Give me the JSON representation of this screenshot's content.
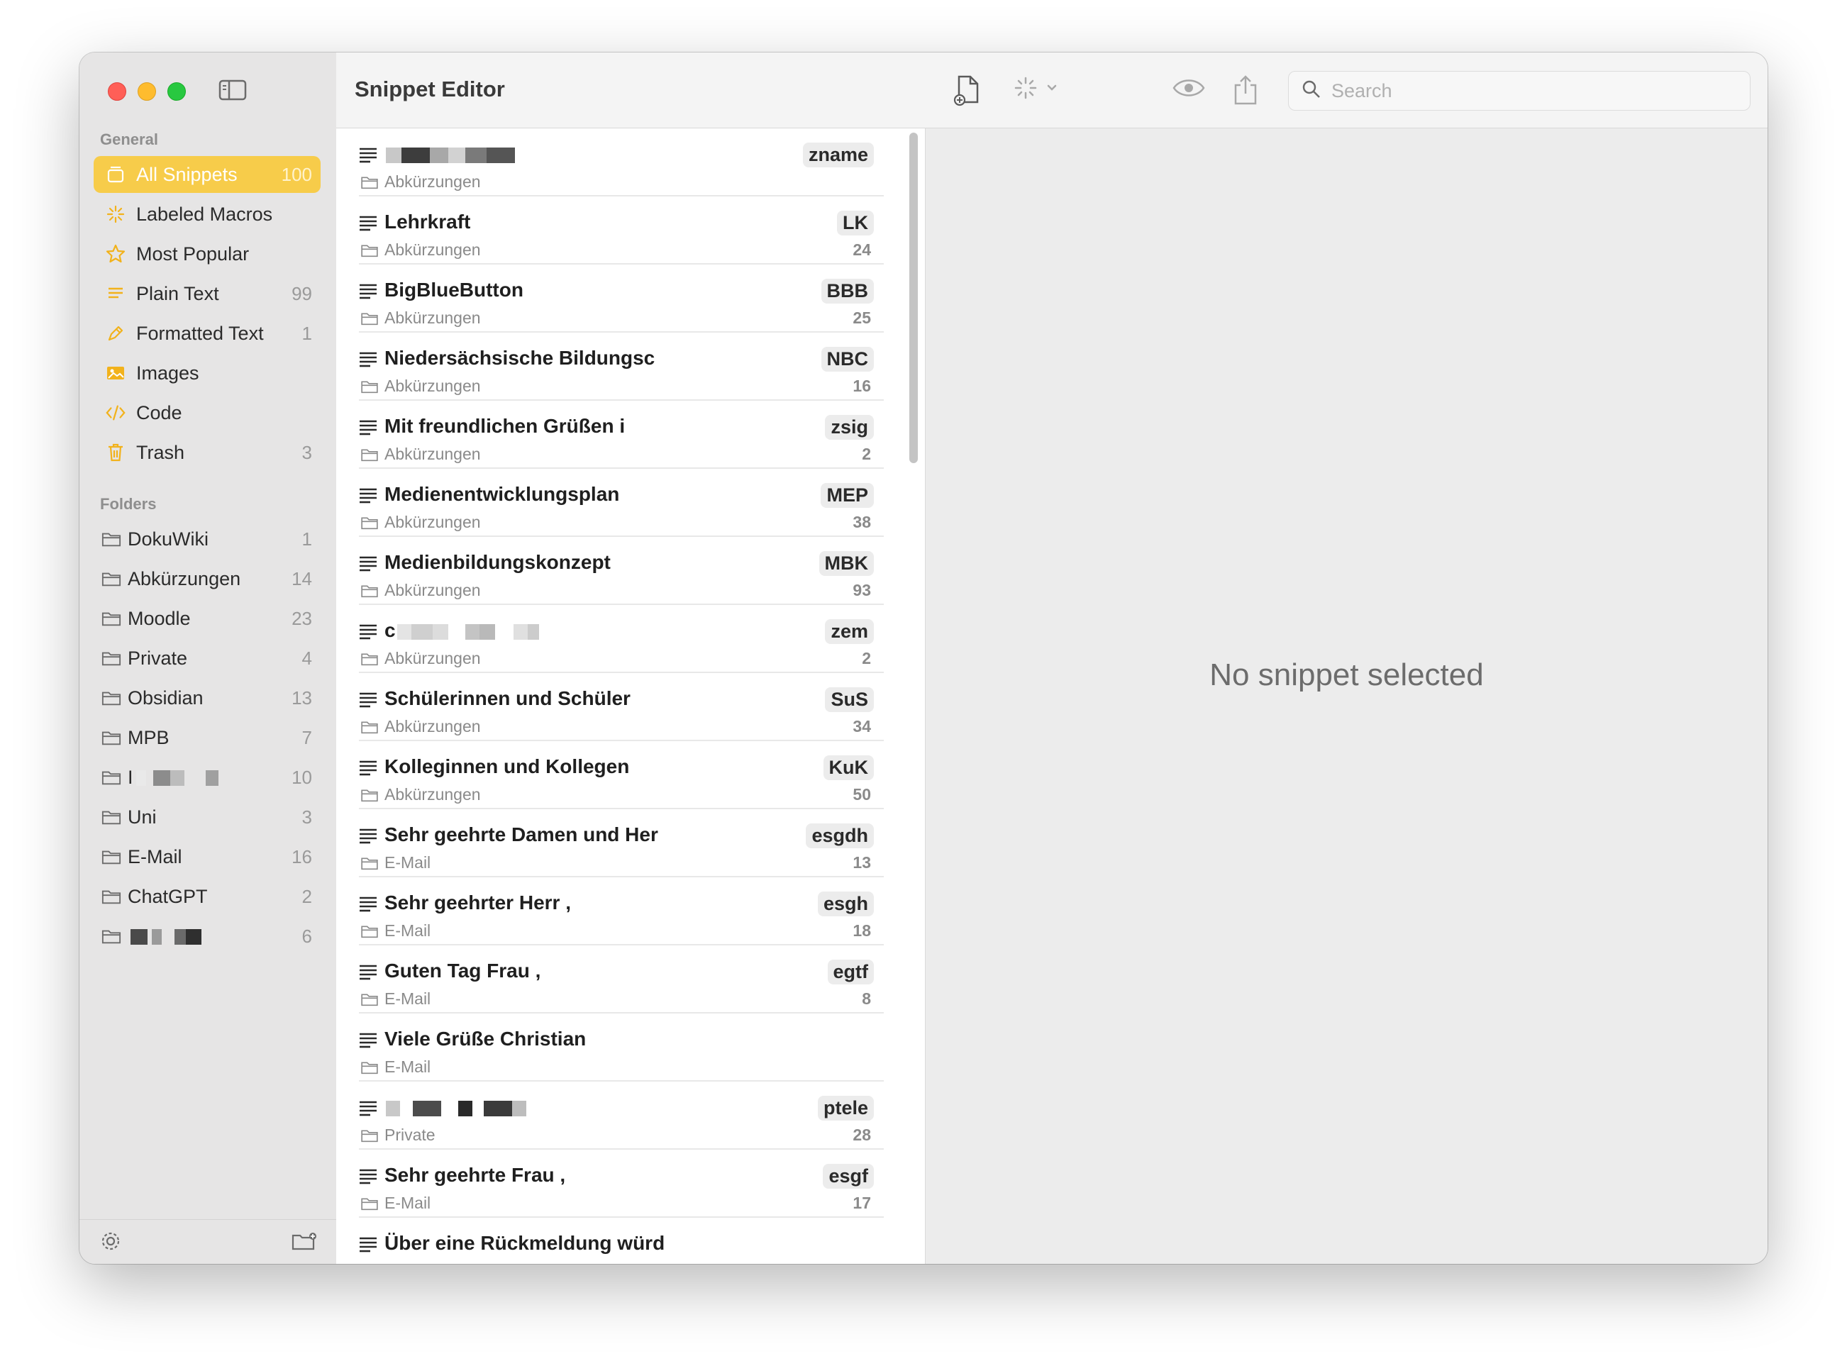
{
  "app": {
    "title": "Snippet Editor",
    "search_placeholder": "Search",
    "empty_state": "No snippet selected"
  },
  "colors": {
    "accent": "#f7cc4a",
    "sidebar_bg": "#e6e5e5",
    "icon_yellow": "#f2b21b"
  },
  "sidebar": {
    "general_label": "General",
    "folders_label": "Folders",
    "general": [
      {
        "label": "All Snippets",
        "count": "100",
        "icon": "tray-icon",
        "active": true
      },
      {
        "label": "Labeled Macros",
        "count": "",
        "icon": "sparkle-icon"
      },
      {
        "label": "Most Popular",
        "count": "",
        "icon": "star-icon"
      },
      {
        "label": "Plain Text",
        "count": "99",
        "icon": "text-lines-icon"
      },
      {
        "label": "Formatted Text",
        "count": "1",
        "icon": "pen-icon"
      },
      {
        "label": "Images",
        "count": "",
        "icon": "image-icon"
      },
      {
        "label": "Code",
        "count": "",
        "icon": "code-icon"
      },
      {
        "label": "Trash",
        "count": "3",
        "icon": "trash-icon"
      }
    ],
    "folders": [
      {
        "label": "DokuWiki",
        "count": "1"
      },
      {
        "label": "Abkürzungen",
        "count": "14"
      },
      {
        "label": "Moodle",
        "count": "23"
      },
      {
        "label": "Private",
        "count": "4"
      },
      {
        "label": "Obsidian",
        "count": "13"
      },
      {
        "label": "MPB",
        "count": "7"
      },
      {
        "label": "I",
        "count": "10",
        "redacted": true
      },
      {
        "label": "Uni",
        "count": "3"
      },
      {
        "label": "E-Mail",
        "count": "16"
      },
      {
        "label": "ChatGPT",
        "count": "2"
      },
      {
        "label": "",
        "count": "6",
        "redacted": true
      }
    ]
  },
  "snippets": [
    {
      "name": "",
      "abbr": "zname",
      "folder": "Abkürzungen",
      "uses": "",
      "redacted": true
    },
    {
      "name": "Lehrkraft",
      "abbr": "LK",
      "folder": "Abkürzungen",
      "uses": "24"
    },
    {
      "name": "BigBlueButton",
      "abbr": "BBB",
      "folder": "Abkürzungen",
      "uses": "25"
    },
    {
      "name": "Niedersächsische Bildungsc",
      "abbr": "NBC",
      "folder": "Abkürzungen",
      "uses": "16"
    },
    {
      "name": "Mit freundlichen Grüßen  i",
      "abbr": "zsig",
      "folder": "Abkürzungen",
      "uses": "2"
    },
    {
      "name": "Medienentwicklungsplan",
      "abbr": "MEP",
      "folder": "Abkürzungen",
      "uses": "38"
    },
    {
      "name": "Medienbildungskonzept",
      "abbr": "MBK",
      "folder": "Abkürzungen",
      "uses": "93"
    },
    {
      "name": "c",
      "abbr": "zem",
      "folder": "Abkürzungen",
      "uses": "2",
      "redacted": true
    },
    {
      "name": "Schülerinnen und Schüler",
      "abbr": "SuS",
      "folder": "Abkürzungen",
      "uses": "34"
    },
    {
      "name": "Kolleginnen und Kollegen",
      "abbr": "KuK",
      "folder": "Abkürzungen",
      "uses": "50"
    },
    {
      "name": "Sehr geehrte Damen und Her",
      "abbr": "esgdh",
      "folder": "E-Mail",
      "uses": "13"
    },
    {
      "name": "Sehr geehrter Herr ,",
      "abbr": "esgh",
      "folder": "E-Mail",
      "uses": "18"
    },
    {
      "name": "Guten Tag Frau ,",
      "abbr": "egtf",
      "folder": "E-Mail",
      "uses": "8"
    },
    {
      "name": "Viele Grüße Christian",
      "abbr": "",
      "folder": "E-Mail",
      "uses": ""
    },
    {
      "name": "",
      "abbr": "ptele",
      "folder": "Private",
      "uses": "28",
      "redacted": true
    },
    {
      "name": "Sehr geehrte Frau ,",
      "abbr": "esgf",
      "folder": "E-Mail",
      "uses": "17"
    },
    {
      "name": "Über eine Rückmeldung würd",
      "abbr": "",
      "folder": "",
      "uses": ""
    }
  ]
}
